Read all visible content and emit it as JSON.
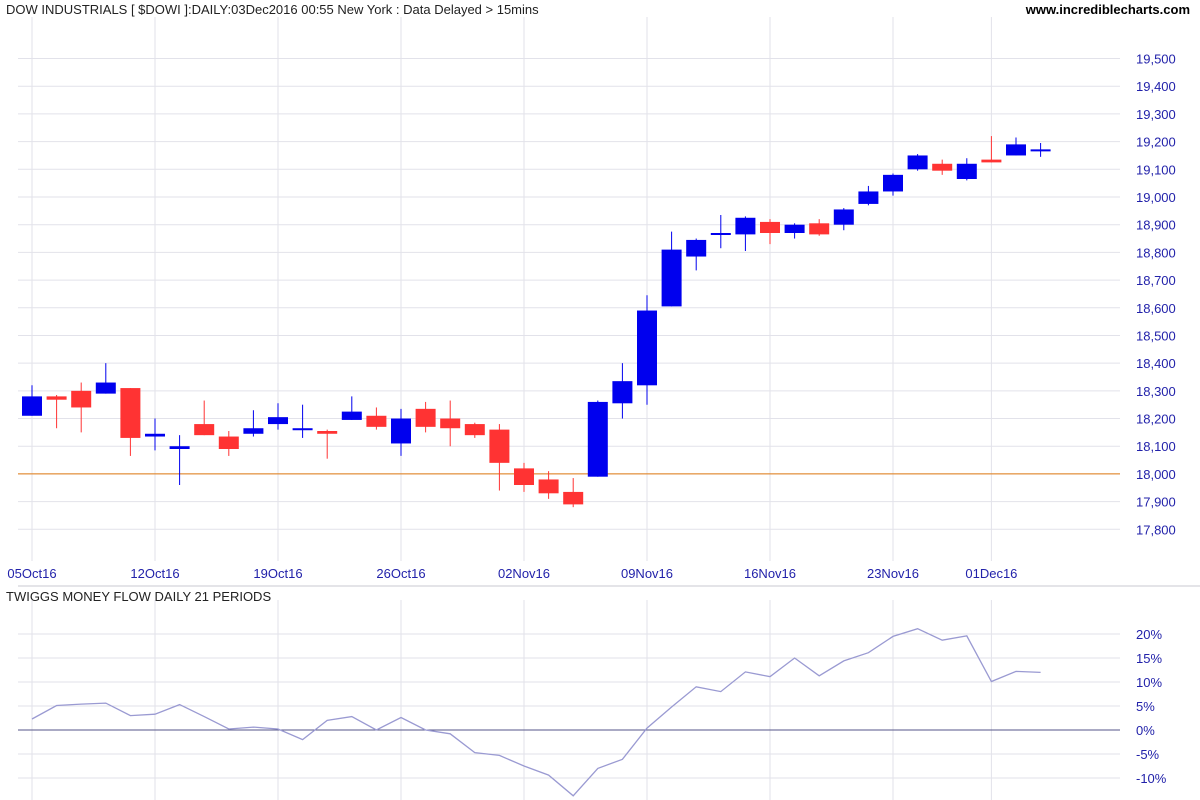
{
  "header": {
    "title": "DOW INDUSTRIALS [ $DOWI ]:DAILY:03Dec2016 00:55 New York : Data Delayed > 15mins",
    "site": "www.incrediblecharts.com"
  },
  "colors": {
    "up": "#0000ee",
    "down": "#ff3333",
    "grid": "#e2e2ea",
    "axis_text": "#2222aa",
    "reference_line": "#e07a10",
    "indicator_line": "#9a9ad2",
    "zero_line": "#555588"
  },
  "chart_data": [
    {
      "type": "candlestick",
      "title": "DOW INDUSTRIALS [ $DOWI ]:DAILY:03Dec2016 00:55 New York : Data Delayed > 15mins",
      "ylim": [
        17700,
        19650
      ],
      "y_ticks": [
        17800,
        17900,
        18000,
        18100,
        18200,
        18300,
        18400,
        18500,
        18600,
        18700,
        18800,
        18900,
        19000,
        19100,
        19200,
        19300,
        19400,
        19500
      ],
      "y_tick_labels": [
        "17,800",
        "17,900",
        "18,000",
        "18,100",
        "18,200",
        "18,300",
        "18,400",
        "18,500",
        "18,600",
        "18,700",
        "18,800",
        "18,900",
        "19,000",
        "19,100",
        "19,200",
        "19,300",
        "19,400",
        "19,500"
      ],
      "x_ticks": [
        {
          "index": 0,
          "label": "05Oct16"
        },
        {
          "index": 5,
          "label": "12Oct16"
        },
        {
          "index": 10,
          "label": "19Oct16"
        },
        {
          "index": 15,
          "label": "26Oct16"
        },
        {
          "index": 20,
          "label": "02Nov16"
        },
        {
          "index": 25,
          "label": "09Nov16"
        },
        {
          "index": 30,
          "label": "16Nov16"
        },
        {
          "index": 35,
          "label": "23Nov16"
        },
        {
          "index": 39,
          "label": "01Dec16"
        }
      ],
      "reference_line": 18000,
      "candles": [
        {
          "date": "05Oct16",
          "o": 18210,
          "h": 18320,
          "l": 18210,
          "c": 18280
        },
        {
          "date": "06Oct16",
          "o": 18280,
          "h": 18285,
          "l": 18165,
          "c": 18268
        },
        {
          "date": "07Oct16",
          "o": 18300,
          "h": 18330,
          "l": 18150,
          "c": 18240
        },
        {
          "date": "10Oct16",
          "o": 18290,
          "h": 18400,
          "l": 18290,
          "c": 18330
        },
        {
          "date": "11Oct16",
          "o": 18310,
          "h": 18310,
          "l": 18065,
          "c": 18130
        },
        {
          "date": "12Oct16",
          "o": 18135,
          "h": 18200,
          "l": 18085,
          "c": 18145
        },
        {
          "date": "13Oct16",
          "o": 18090,
          "h": 18140,
          "l": 17960,
          "c": 18100
        },
        {
          "date": "14Oct16",
          "o": 18180,
          "h": 18265,
          "l": 18140,
          "c": 18140
        },
        {
          "date": "17Oct16",
          "o": 18135,
          "h": 18155,
          "l": 18065,
          "c": 18090
        },
        {
          "date": "18Oct16",
          "o": 18145,
          "h": 18230,
          "l": 18135,
          "c": 18165
        },
        {
          "date": "19Oct16",
          "o": 18180,
          "h": 18255,
          "l": 18160,
          "c": 18205
        },
        {
          "date": "20Oct16",
          "o": 18160,
          "h": 18250,
          "l": 18130,
          "c": 18165
        },
        {
          "date": "21Oct16",
          "o": 18155,
          "h": 18160,
          "l": 18055,
          "c": 18145
        },
        {
          "date": "24Oct16",
          "o": 18195,
          "h": 18280,
          "l": 18195,
          "c": 18225
        },
        {
          "date": "25Oct16",
          "o": 18210,
          "h": 18240,
          "l": 18160,
          "c": 18170
        },
        {
          "date": "26Oct16",
          "o": 18110,
          "h": 18235,
          "l": 18065,
          "c": 18200
        },
        {
          "date": "27Oct16",
          "o": 18235,
          "h": 18260,
          "l": 18150,
          "c": 18170
        },
        {
          "date": "28Oct16",
          "o": 18200,
          "h": 18265,
          "l": 18100,
          "c": 18165
        },
        {
          "date": "31Oct16",
          "o": 18180,
          "h": 18185,
          "l": 18130,
          "c": 18140
        },
        {
          "date": "01Nov16",
          "o": 18160,
          "h": 18180,
          "l": 17940,
          "c": 18040
        },
        {
          "date": "02Nov16",
          "o": 18020,
          "h": 18040,
          "l": 17935,
          "c": 17960
        },
        {
          "date": "03Nov16",
          "o": 17980,
          "h": 18010,
          "l": 17910,
          "c": 17930
        },
        {
          "date": "04Nov16",
          "o": 17935,
          "h": 17985,
          "l": 17880,
          "c": 17890
        },
        {
          "date": "07Nov16",
          "o": 17990,
          "h": 18265,
          "l": 17990,
          "c": 18260
        },
        {
          "date": "08Nov16",
          "o": 18255,
          "h": 18400,
          "l": 18200,
          "c": 18335
        },
        {
          "date": "09Nov16",
          "o": 18320,
          "h": 18645,
          "l": 18250,
          "c": 18590
        },
        {
          "date": "10Nov16",
          "o": 18605,
          "h": 18875,
          "l": 18605,
          "c": 18810
        },
        {
          "date": "11Nov16",
          "o": 18785,
          "h": 18850,
          "l": 18735,
          "c": 18845
        },
        {
          "date": "14Nov16",
          "o": 18868,
          "h": 18935,
          "l": 18815,
          "c": 18870
        },
        {
          "date": "15Nov16",
          "o": 18865,
          "h": 18930,
          "l": 18805,
          "c": 18925
        },
        {
          "date": "16Nov16",
          "o": 18910,
          "h": 18920,
          "l": 18830,
          "c": 18870
        },
        {
          "date": "17Nov16",
          "o": 18870,
          "h": 18905,
          "l": 18850,
          "c": 18900
        },
        {
          "date": "18Nov16",
          "o": 18905,
          "h": 18920,
          "l": 18860,
          "c": 18865
        },
        {
          "date": "21Nov16",
          "o": 18900,
          "h": 18960,
          "l": 18880,
          "c": 18955
        },
        {
          "date": "22Nov16",
          "o": 18975,
          "h": 19040,
          "l": 18970,
          "c": 19020
        },
        {
          "date": "23Nov16",
          "o": 19020,
          "h": 19085,
          "l": 19005,
          "c": 19080
        },
        {
          "date": "25Nov16",
          "o": 19100,
          "h": 19155,
          "l": 19095,
          "c": 19150
        },
        {
          "date": "28Nov16",
          "o": 19120,
          "h": 19135,
          "l": 19080,
          "c": 19095
        },
        {
          "date": "29Nov16",
          "o": 19065,
          "h": 19140,
          "l": 19060,
          "c": 19120
        },
        {
          "date": "30Nov16",
          "o": 19135,
          "h": 19220,
          "l": 19125,
          "c": 19125
        },
        {
          "date": "01Dec16",
          "o": 19150,
          "h": 19215,
          "l": 19150,
          "c": 19190
        },
        {
          "date": "02Dec16",
          "o": 19165,
          "h": 19195,
          "l": 19145,
          "c": 19172
        }
      ]
    },
    {
      "type": "line",
      "title": "TWIGGS MONEY FLOW DAILY 21 PERIODS",
      "ylim": [
        -12.5,
        25
      ],
      "y_ticks": [
        20,
        15,
        10,
        5,
        0,
        -5,
        -10
      ],
      "y_tick_labels": [
        "20%",
        "15%",
        "10%",
        "5%",
        "0%",
        "-5%",
        "-10%"
      ],
      "zero_line": 0,
      "series": [
        {
          "values": [
            2.3,
            5.1,
            5.4,
            5.6,
            3.0,
            3.3,
            5.3,
            2.8,
            0.2,
            0.6,
            0.2,
            -2.0,
            2.0,
            2.8,
            0.0,
            2.6,
            0.0,
            -0.8,
            -4.7,
            -5.3,
            -7.5,
            -9.4,
            -13.7,
            -8.0,
            -6.1,
            0.4,
            4.8,
            9.0,
            8.0,
            12.1,
            11.1,
            15.0,
            11.3,
            14.4,
            16.1,
            19.5,
            21.1,
            18.7,
            19.6,
            10.1,
            12.2,
            12.0
          ]
        }
      ]
    }
  ]
}
